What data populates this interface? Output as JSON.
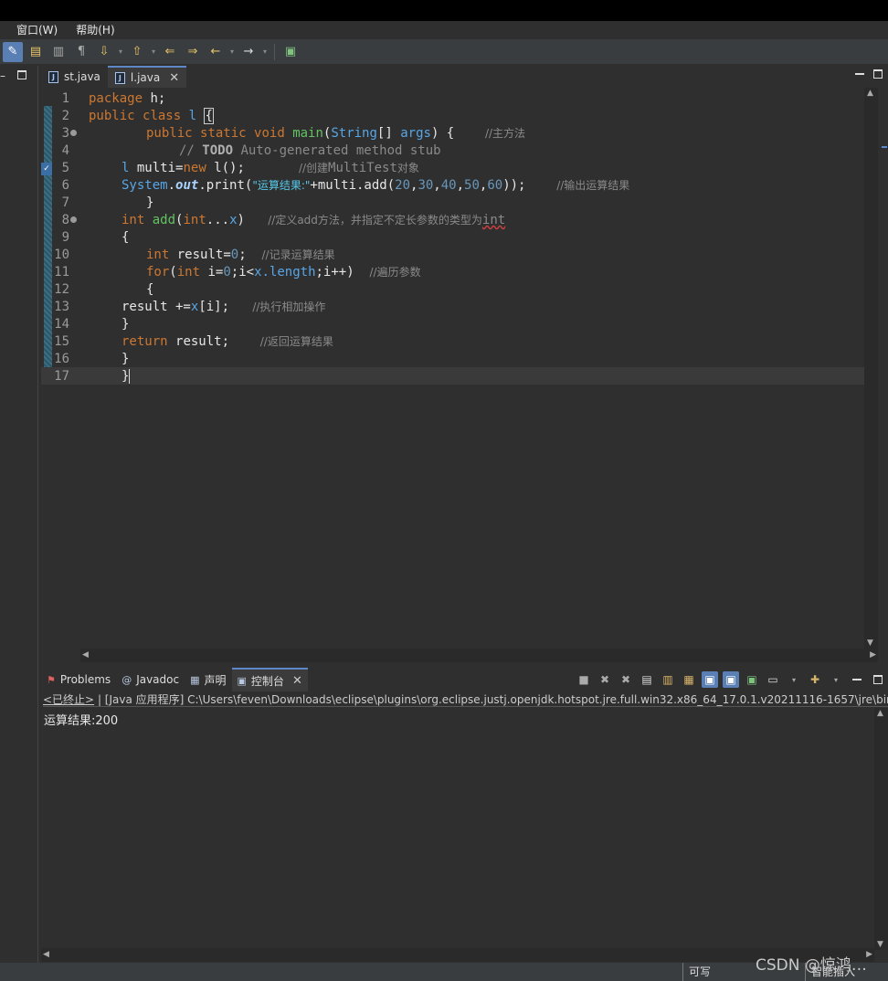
{
  "menu": {
    "items": [
      "窗口(W)",
      "帮助(H)"
    ]
  },
  "editor": {
    "tabs": [
      {
        "label": "st.java",
        "active": false
      },
      {
        "label": "l.java",
        "active": true
      }
    ],
    "line_numbers": [
      "1",
      "2",
      "3",
      "4",
      "5",
      "6",
      "7",
      "8",
      "9",
      "10",
      "11",
      "12",
      "13",
      "14",
      "15",
      "16",
      "17"
    ],
    "code": {
      "l1": {
        "kw": "package",
        "rest": " h;"
      },
      "l2": {
        "kw1": "public",
        "kw2": "class",
        "name": "l",
        "brace": "{"
      },
      "l3": {
        "kw1": "public",
        "kw2": "static",
        "kw3": "void",
        "fn": "main",
        "type": "String",
        "args": "args",
        "tail": ") {",
        "comment": "//主方法"
      },
      "l4": {
        "prefix": "// ",
        "todo": "TODO",
        "rest": " Auto-generated method stub"
      },
      "l5": {
        "type": "l",
        "var": "multi",
        "eq": "=",
        "kw": "new",
        "call": "l();",
        "comment_prefix": "//创建",
        "comment_mono": "MultiTest",
        "comment_suffix": "对象"
      },
      "l6": {
        "cls": "System",
        "field": "out",
        "method": "print(",
        "str": "\"运算结果:\"",
        "plus": "+multi.add(",
        "n1": "20",
        "n2": "30",
        "n3": "40",
        "n4": "50",
        "n5": "60",
        "end": "));",
        "comment": "//输出运算结果"
      },
      "l7": {
        "text": "}"
      },
      "l8": {
        "kw": "int",
        "fn": "add",
        "kw2": "int",
        "dots": "...",
        "param": "x",
        "close": ")",
        "comment": "//定义add方法，并指定不定长参数的类型为",
        "comment_kw": "int"
      },
      "l9": {
        "text": "{"
      },
      "l10": {
        "kw": "int",
        "var": "result",
        "eq": "=",
        "num": "0",
        "semi": ";",
        "comment": "//记录运算结果"
      },
      "l11": {
        "kw": "for",
        "kw2": "int",
        "a": "i=",
        "zero": "0",
        "b": ";i<",
        "field": "x.length",
        "c": ";i++)",
        "comment": "//遍历参数"
      },
      "l12": {
        "text": "{"
      },
      "l13": {
        "var": "result",
        "op": " +=",
        "field": "x",
        "idx": "[i];",
        "comment": "//执行相加操作"
      },
      "l14": {
        "text": "}"
      },
      "l15": {
        "kw": "return",
        "var": "result;",
        "comment": "//返回运算结果"
      },
      "l16": {
        "text": "}"
      },
      "l17": {
        "text": "}"
      }
    }
  },
  "console": {
    "tabs": [
      {
        "label": "Problems",
        "icon": "problems-icon"
      },
      {
        "label": "Javadoc",
        "icon": "javadoc-icon"
      },
      {
        "label": "声明",
        "icon": "declaration-icon"
      },
      {
        "label": "控制台",
        "icon": "console-icon",
        "active": true
      }
    ],
    "status_terminated": "<已终止>",
    "status_rest": " | [Java 应用程序] C:\\Users\\feven\\Downloads\\eclipse\\plugins\\org.eclipse.justj.openjdk.hotspot.jre.full.win32.x86_64_17.0.1.v20211116-1657\\jre\\bin\\javaw",
    "output": "运算结果:200"
  },
  "statusbar": {
    "writable": "可写",
    "insert_mode": "智能插入"
  },
  "watermark": "CSDN @惊鸿…",
  "colors": {
    "keyword": "#cc7832",
    "method": "#63c263",
    "type": "#58a6e6",
    "number": "#6897bb",
    "string": "#55c8e8",
    "comment": "#8a8a8a",
    "accent": "#5d87c6"
  }
}
